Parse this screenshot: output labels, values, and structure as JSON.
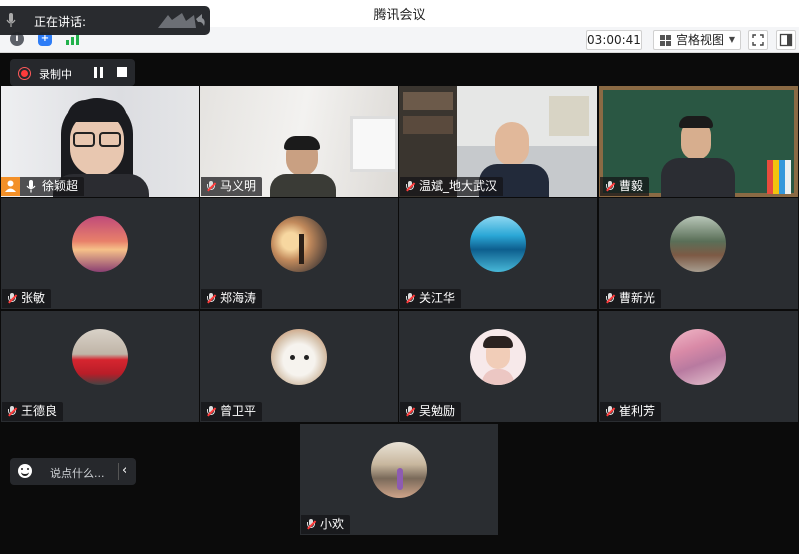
{
  "app": {
    "title": "腾讯会议"
  },
  "speaking": {
    "label": "正在讲话:"
  },
  "toolbar": {
    "timer": "03:00:41",
    "view_label": "宫格视图"
  },
  "recording": {
    "label": "录制中"
  },
  "chat": {
    "placeholder": "说点什么..."
  },
  "participants": [
    {
      "name": "徐颖超",
      "host": true,
      "video": true
    },
    {
      "name": "马义明",
      "video": true
    },
    {
      "name": "温斌_地大武汉",
      "video": true
    },
    {
      "name": "曹毅",
      "video": true
    },
    {
      "name": "张敏"
    },
    {
      "name": "郑海涛"
    },
    {
      "name": "关江华"
    },
    {
      "name": "曹新光"
    },
    {
      "name": "王德良"
    },
    {
      "name": "曾卫平"
    },
    {
      "name": "吴勉励"
    },
    {
      "name": "崔利芳"
    },
    {
      "name": "小欢"
    }
  ]
}
